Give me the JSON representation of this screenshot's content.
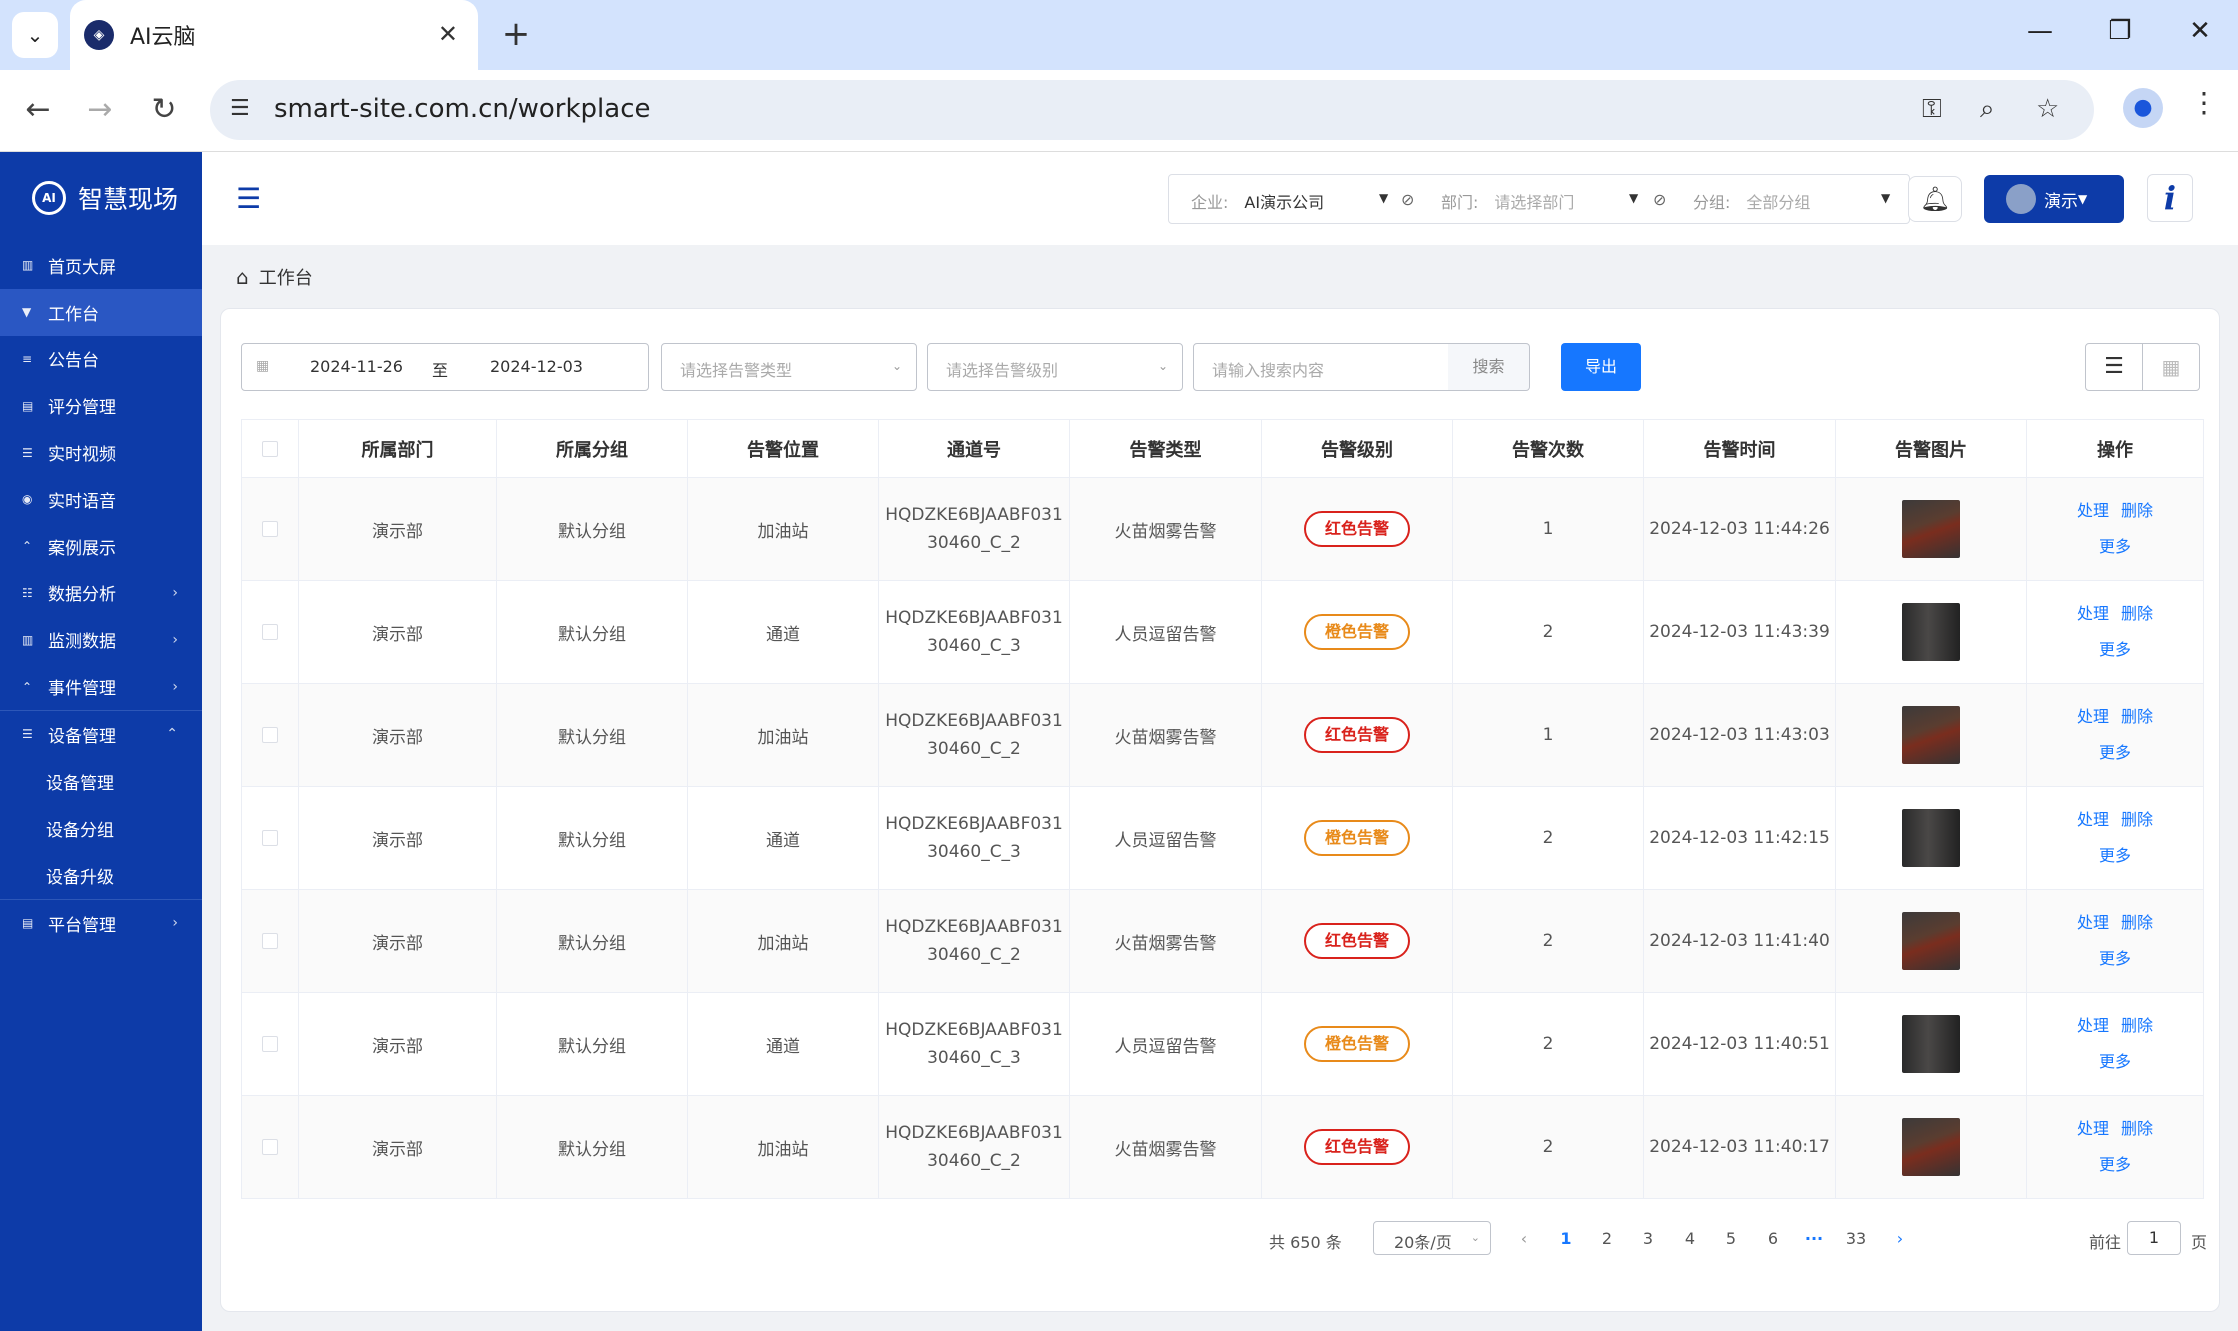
{
  "browser": {
    "tab_title": "AI云脑",
    "url": "smart-site.com.cn/workplace"
  },
  "sidebar": {
    "brand": "智慧现场",
    "items": [
      {
        "label": "首页大屏",
        "icon": "dashboard-icon"
      },
      {
        "label": "工作台",
        "icon": "workbench-icon",
        "active": true
      },
      {
        "label": "公告台",
        "icon": "notice-icon"
      },
      {
        "label": "评分管理",
        "icon": "score-icon"
      },
      {
        "label": "实时视频",
        "icon": "video-icon"
      },
      {
        "label": "实时语音",
        "icon": "voice-icon"
      },
      {
        "label": "案例展示",
        "icon": "case-icon"
      },
      {
        "label": "数据分析",
        "icon": "analysis-icon",
        "expandable": true
      },
      {
        "label": "监测数据",
        "icon": "monitor-icon",
        "expandable": true
      },
      {
        "label": "事件管理",
        "icon": "event-icon",
        "expandable": true
      },
      {
        "label": "设备管理",
        "icon": "device-icon",
        "expanded": true
      }
    ],
    "sub_items": [
      "设备管理",
      "设备分组",
      "设备升级"
    ],
    "last_item": {
      "label": "平台管理",
      "icon": "platform-icon"
    }
  },
  "header": {
    "enterprise_label": "企业:",
    "enterprise_value": "AI演示公司",
    "dept_label": "部门:",
    "dept_placeholder": "请选择部门",
    "group_label": "分组:",
    "group_value": "全部分组",
    "user_name": "演示",
    "info_glyph": "i"
  },
  "breadcrumb": "工作台",
  "toolbar": {
    "date_start": "2024-11-26",
    "date_sep": "至",
    "date_end": "2024-12-03",
    "type_placeholder": "请选择告警类型",
    "level_placeholder": "请选择告警级别",
    "search_placeholder": "请输入搜索内容",
    "search_label": "搜索",
    "export_label": "导出"
  },
  "table": {
    "headers": [
      "所属部门",
      "所属分组",
      "告警位置",
      "通道号",
      "告警类型",
      "告警级别",
      "告警次数",
      "告警时间",
      "告警图片",
      "操作"
    ],
    "rows": [
      {
        "dept": "演示部",
        "group": "默认分组",
        "loc": "加油站",
        "ch1": "HQDZKE6BJAABF031",
        "ch2": "30460_C_2",
        "type": "火苗烟雾告警",
        "level": "红色告警",
        "level_kind": "red",
        "count": "1",
        "time": "2024-12-03 11:44:26",
        "img": "fire"
      },
      {
        "dept": "演示部",
        "group": "默认分组",
        "loc": "通道",
        "ch1": "HQDZKE6BJAABF031",
        "ch2": "30460_C_3",
        "type": "人员逗留告警",
        "level": "橙色告警",
        "level_kind": "orange",
        "count": "2",
        "time": "2024-12-03 11:43:39",
        "img": "dark"
      },
      {
        "dept": "演示部",
        "group": "默认分组",
        "loc": "加油站",
        "ch1": "HQDZKE6BJAABF031",
        "ch2": "30460_C_2",
        "type": "火苗烟雾告警",
        "level": "红色告警",
        "level_kind": "red",
        "count": "1",
        "time": "2024-12-03 11:43:03",
        "img": "fire"
      },
      {
        "dept": "演示部",
        "group": "默认分组",
        "loc": "通道",
        "ch1": "HQDZKE6BJAABF031",
        "ch2": "30460_C_3",
        "type": "人员逗留告警",
        "level": "橙色告警",
        "level_kind": "orange",
        "count": "2",
        "time": "2024-12-03 11:42:15",
        "img": "dark"
      },
      {
        "dept": "演示部",
        "group": "默认分组",
        "loc": "加油站",
        "ch1": "HQDZKE6BJAABF031",
        "ch2": "30460_C_2",
        "type": "火苗烟雾告警",
        "level": "红色告警",
        "level_kind": "red",
        "count": "2",
        "time": "2024-12-03 11:41:40",
        "img": "fire"
      },
      {
        "dept": "演示部",
        "group": "默认分组",
        "loc": "通道",
        "ch1": "HQDZKE6BJAABF031",
        "ch2": "30460_C_3",
        "type": "人员逗留告警",
        "level": "橙色告警",
        "level_kind": "orange",
        "count": "2",
        "time": "2024-12-03 11:40:51",
        "img": "dark"
      },
      {
        "dept": "演示部",
        "group": "默认分组",
        "loc": "加油站",
        "ch1": "HQDZKE6BJAABF031",
        "ch2": "30460_C_2",
        "type": "火苗烟雾告警",
        "level": "红色告警",
        "level_kind": "red",
        "count": "2",
        "time": "2024-12-03 11:40:17",
        "img": "fire"
      }
    ],
    "op_handle": "处理",
    "op_delete": "删除",
    "op_more": "更多"
  },
  "pagination": {
    "total": "共 650 条",
    "page_size": "20条/页",
    "pages": [
      "1",
      "2",
      "3",
      "4",
      "5",
      "6"
    ],
    "ellipsis": "···",
    "last_page": "33",
    "goto_label": "前往",
    "goto_value": "1",
    "page_unit": "页"
  },
  "colors": {
    "sidebar": "#0d3ba8",
    "primary": "#1677ff",
    "red_alert": "#d9221c",
    "orange_alert": "#e88a1a"
  }
}
